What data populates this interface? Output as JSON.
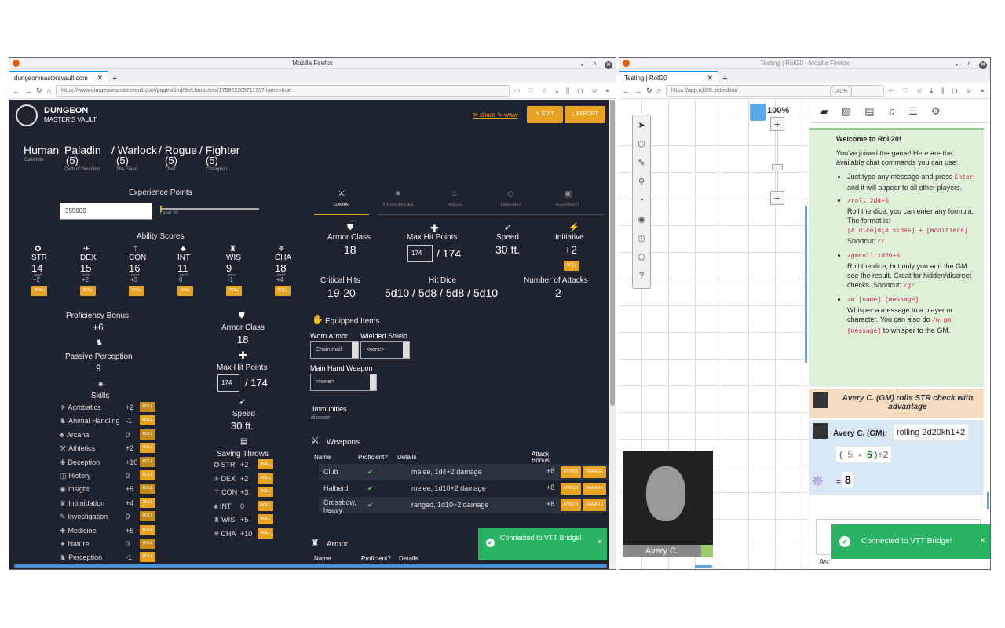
{
  "left_window": {
    "title": "Mozilla Firefox",
    "tab": "dungeonmastersvault.com",
    "url": "https://www.dungeonmastersvault.com/pages/dnd/5e/characters/17592220571171?frame=true"
  },
  "right_window": {
    "title": "Testing | Roll20 - Mozilla Firefox",
    "tab": "Testing | Roll20",
    "url": "https://app.roll20.net/editor/",
    "zoom_badge": "140%"
  },
  "dmv": {
    "logo_top": "DUNGEON",
    "logo_bottom": "MASTER'S VAULT",
    "share": "share",
    "www": "www",
    "edit": "EDIT",
    "export": "EXPORT",
    "race": "Human",
    "subrace": "Callishite",
    "classes": [
      {
        "name": "Paladin",
        "level": "(5)",
        "sub": "Oath of Devotion"
      },
      {
        "name": "/ Warlock",
        "level": "(5)",
        "sub": "The Fiend"
      },
      {
        "name": "/ Rogue",
        "level": "(5)",
        "sub": "Thief"
      },
      {
        "name": "/ Fighter",
        "level": "(5)",
        "sub": "Champion"
      }
    ],
    "xp_label": "Experience Points",
    "xp_value": "355000",
    "xp_level": "Level 20",
    "ability_title": "Ability Scores",
    "abilities": [
      {
        "n": "STR",
        "v": "14",
        "m": "+2"
      },
      {
        "n": "DEX",
        "v": "15",
        "m": "+2"
      },
      {
        "n": "CON",
        "v": "16",
        "m": "+3"
      },
      {
        "n": "INT",
        "v": "11",
        "m": "0"
      },
      {
        "n": "WIS",
        "v": "9",
        "m": "-1"
      },
      {
        "n": "CHA",
        "v": "18",
        "m": "+4"
      }
    ],
    "mod_label": "mod",
    "roll": "ROLL",
    "prof_label": "Proficiency Bonus",
    "prof_value": "+6",
    "pp_label": "Passive Perception",
    "pp_value": "9",
    "skills_label": "Skills",
    "skills": [
      {
        "n": "Acrobatics",
        "v": "+2"
      },
      {
        "n": "Animal Handling",
        "v": "-1"
      },
      {
        "n": "Arcana",
        "v": "0"
      },
      {
        "n": "Athletics",
        "v": "+2"
      },
      {
        "n": "Deception",
        "v": "+10"
      },
      {
        "n": "History",
        "v": "0"
      },
      {
        "n": "Insight",
        "v": "+5"
      },
      {
        "n": "Intimidation",
        "v": "+4"
      },
      {
        "n": "Investigation",
        "v": "0"
      },
      {
        "n": "Medicine",
        "v": "+5"
      },
      {
        "n": "Nature",
        "v": "0"
      },
      {
        "n": "Perception",
        "v": "-1"
      }
    ],
    "mid_ac_label": "Armor Class",
    "mid_ac": "18",
    "mid_hp_label": "Max Hit Points",
    "mid_hp_cur": "174",
    "mid_hp_max": "/ 174",
    "mid_speed_label": "Speed",
    "mid_speed": "30 ft.",
    "saves_label": "Saving Throws",
    "saves": [
      {
        "n": "STR",
        "v": "+2"
      },
      {
        "n": "DEX",
        "v": "+2"
      },
      {
        "n": "CON",
        "v": "+3"
      },
      {
        "n": "INT",
        "v": "0"
      },
      {
        "n": "WIS",
        "v": "+5"
      },
      {
        "n": "CHA",
        "v": "+10"
      }
    ],
    "tabs": [
      "COMBAT",
      "PROFICIENCIES",
      "SPELLS",
      "FEATURES",
      "EQUIPMENT"
    ],
    "combat": {
      "ac_label": "Armor Class",
      "ac": "18",
      "hp_label": "Max Hit Points",
      "hp_cur": "174",
      "hp_max": "/ 174",
      "speed_label": "Speed",
      "speed": "30 ft.",
      "init_label": "Initiative",
      "init": "+2",
      "crit_label": "Critical Hits",
      "crit": "19-20",
      "hd_label": "Hit Dice",
      "hd": "5d10 / 5d8 / 5d8 / 5d10",
      "att_label": "Number of Attacks",
      "att": "2"
    },
    "equipped_label": "Equipped Items",
    "worn_label": "Worn Armor",
    "worn": "Chain mail",
    "shield_label": "Wielded Shield",
    "shield": "<none>",
    "main_label": "Main Hand Weapon",
    "main": "<none>",
    "imm_label": "Immunities",
    "imm": "disease",
    "weapons_label": "Weapons",
    "wh": {
      "name": "Name",
      "prof": "Proficient?",
      "det": "Details",
      "att": "Attack Bonus"
    },
    "weapons": [
      {
        "n": "Club",
        "d": "melee, 1d4+2 damage",
        "b": "+8"
      },
      {
        "n": "Halberd",
        "d": "melee, 1d10+2 damage",
        "b": "+8"
      },
      {
        "n": "Crossbow, heavy",
        "d": "ranged, 1d10+2 damage",
        "b": "+8"
      }
    ],
    "attack": "ATTACK",
    "damage": "DAMAGE",
    "armor_label": "Armor",
    "ah": {
      "name": "Name",
      "prof": "Proficient?",
      "det": "Details"
    },
    "toast": "Connected to VTT Bridge!"
  },
  "roll20": {
    "zoom": "100%",
    "avatar_name": "Avery C.",
    "welcome_title": "Welcome to Roll20!",
    "welcome_intro": "You've joined the game! Here are the available chat commands you can use:",
    "cmd1": "Just type any message and press",
    "cmd1_code": "Enter",
    "cmd1_rest": "and it will appear to all other players.",
    "cmd2_code": "/roll 2d4+5",
    "cmd2_desc": "Roll the dice, you can enter any formula. The format is:",
    "cmd2_fmt": "[# dice]d[# sides] + [modifiers]",
    "cmd2_short": "Shortcut:",
    "cmd2_sc": "/r",
    "cmd3_code": "/gmroll 1d20+6",
    "cmd3_desc": "Roll the dice, but only you and the GM see the result. Great for hidden/discreet checks.",
    "cmd3_short": "Shortcut:",
    "cmd3_sc": "/gr",
    "cmd4_code": "/w [name] [message]",
    "cmd4_desc": "Whisper a message to a player or character. You can also do",
    "cmd4_code2": "/w gm [message]",
    "cmd4_rest": "to whisper to the GM.",
    "emote": "Avery C. (GM) rolls STR check with advantage",
    "roller": "Avery C. (GM):",
    "roll_text": "rolling 2d20kh1+2",
    "dice_open": "(",
    "d1": "5",
    "plus": "+",
    "d2": "6",
    "dice_close": ")+2",
    "result_eq": "=",
    "result": "8",
    "as_label": "As:",
    "toast": "Connected to VTT Bridge!"
  }
}
